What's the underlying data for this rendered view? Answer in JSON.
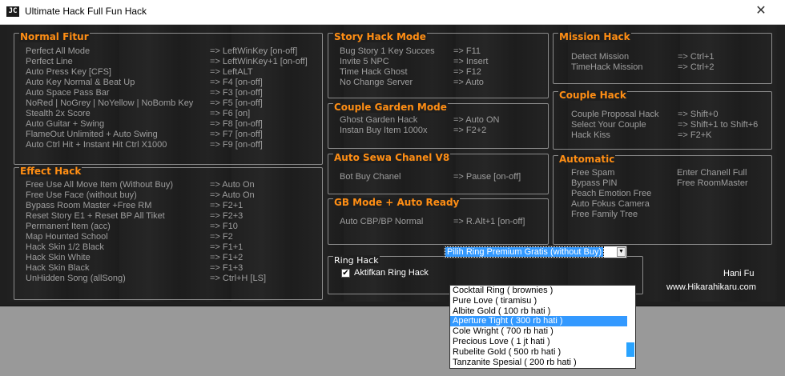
{
  "window": {
    "title": "Ultimate Hack Full Fun Hack",
    "close_glyph": "✕"
  },
  "normal": {
    "title": "Normal Fitur",
    "items": [
      {
        "l": "Perfect All Mode",
        "r": "=> LeftWinKey [on-off]"
      },
      {
        "l": "Perfect Line",
        "r": "=> LeftWinKey+1 [on-off]"
      },
      {
        "l": "Auto Press Key [CFS]",
        "r": "=> LeftALT"
      },
      {
        "l": "Auto Key Normal & Beat Up",
        "r": "=> F4 [on-off]"
      },
      {
        "l": "Auto Space Pass Bar",
        "r": "=> F3 [on-off]"
      },
      {
        "l": "NoRed | NoGrey | NoYellow | NoBomb Key",
        "r": "=> F5 [on-off]"
      },
      {
        "l": "Stealth 2x Score",
        "r": "=> F6 [on]"
      },
      {
        "l": "Auto Guitar + Swing",
        "r": "=> F8 [on-off]"
      },
      {
        "l": "FlameOut Unlimited + Auto Swing",
        "r": "=> F7 [on-off]"
      },
      {
        "l": "Auto Ctrl Hit + Instant Hit Ctrl X1000",
        "r": "=> F9 [on-off]"
      }
    ]
  },
  "effect": {
    "title": "Effect Hack",
    "items": [
      {
        "l": "Free Use All Move Item (Without Buy)",
        "r": "=> Auto On"
      },
      {
        "l": "Free Use Face (without buy)",
        "r": "=> Auto On"
      },
      {
        "l": "Bypass Room Master +Free RM",
        "r": "=> F2+1"
      },
      {
        "l": "Reset Story E1 + Reset BP All Tiket",
        "r": "=> F2+3"
      },
      {
        "l": "Permanent Item (acc)",
        "r": "=> F10"
      },
      {
        "l": "Map Hounted School",
        "r": "=> F2"
      },
      {
        "l": "Hack Skin 1/2 Black",
        "r": "=> F1+1"
      },
      {
        "l": "Hack Skin White",
        "r": "=> F1+2"
      },
      {
        "l": "Hack Skin Black",
        "r": "=> F1+3"
      },
      {
        "l": "UnHidden Song (allSong)",
        "r": "=> Ctrl+H [LS]"
      }
    ]
  },
  "story": {
    "title": "Story Hack Mode",
    "items": [
      {
        "l": "Bug Story 1 Key Succes",
        "r": "=> F11"
      },
      {
        "l": "Invite 5 NPC",
        "r": "=> Insert"
      },
      {
        "l": "Time Hack Ghost",
        "r": "=> F12"
      },
      {
        "l": "No Change Server",
        "r": "=> Auto"
      }
    ]
  },
  "garden": {
    "title": "Couple Garden Mode",
    "items": [
      {
        "l": "Ghost Garden Hack",
        "r": "=> Auto ON"
      },
      {
        "l": "Instan Buy Item 1000x",
        "r": "=> F2+2"
      }
    ]
  },
  "sewa": {
    "title": "Auto Sewa Chanel V8",
    "items": [
      {
        "l": "Bot Buy Chanel",
        "r": "=> Pause [on-off]"
      }
    ]
  },
  "gb": {
    "title": "GB Mode + Auto Ready",
    "items": [
      {
        "l": "Auto CBP/BP Normal",
        "r": "=> R.Alt+1  [on-off]"
      }
    ]
  },
  "mission": {
    "title": "Mission Hack",
    "items": [
      {
        "l": "Detect Mission",
        "r": "=> Ctrl+1"
      },
      {
        "l": "TimeHack Mission",
        "r": "=> Ctrl+2"
      }
    ]
  },
  "couple": {
    "title": "Couple Hack",
    "items": [
      {
        "l": "Couple Proposal Hack",
        "r": "=> Shift+0"
      },
      {
        "l": "Select Your Couple",
        "r": "=> Shift+1 to Shift+6"
      },
      {
        "l": "Hack Kiss",
        "r": "=> F2+K"
      }
    ]
  },
  "automatic": {
    "title": "Automatic",
    "items": [
      {
        "l": "Free Spam",
        "r": "Enter Chanell Full"
      },
      {
        "l": "Bypass PIN",
        "r": "Free RoomMaster"
      },
      {
        "l": "Peach Emotion Free",
        "r": ""
      },
      {
        "l": "Auto Fokus Camera",
        "r": ""
      },
      {
        "l": "Free Family Tree",
        "r": ""
      }
    ]
  },
  "ring": {
    "title": "Ring Hack",
    "checkbox_label": "Aktifkan Ring Hack",
    "checked": true,
    "combo_value": "Pilih Ring Premium Gratis (without Buy)",
    "options": [
      "Cocktail Ring ( brownies )",
      "Pure Love ( tiramisu )",
      "Albite Gold ( 100 rb hati )",
      "Aperture Tight ( 300 rb hati )",
      "Cole Wright ( 700 rb hati )",
      "Precious Love ( 1 jt hati )",
      "Rubelite Gold ( 500 rb hati )",
      "Tanzanite Spesial ( 200 rb hati )"
    ],
    "selected_index": 3
  },
  "credits": {
    "author": "Hani Fu",
    "site": "www.Hikarahikaru.com"
  }
}
